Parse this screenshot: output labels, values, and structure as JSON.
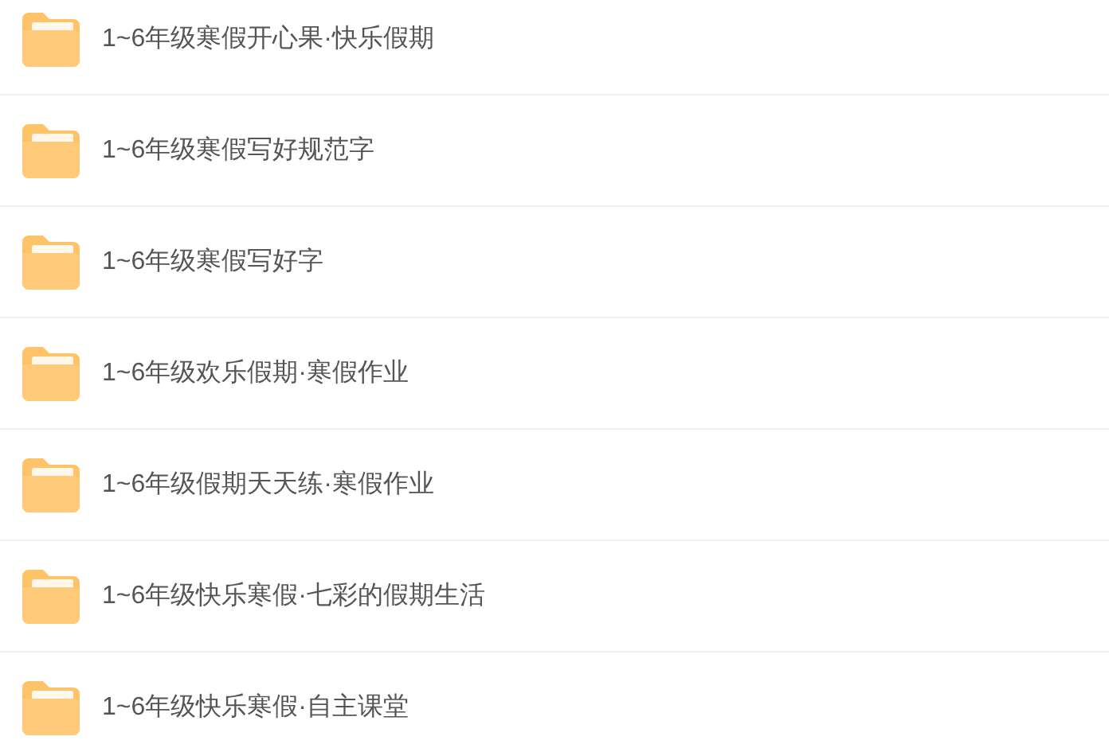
{
  "folders": [
    {
      "name": "1~6年级寒假开心果·快乐假期"
    },
    {
      "name": "1~6年级寒假写好规范字"
    },
    {
      "name": "1~6年级寒假写好字"
    },
    {
      "name": "1~6年级欢乐假期·寒假作业"
    },
    {
      "name": "1~6年级假期天天练·寒假作业"
    },
    {
      "name": "1~6年级快乐寒假·七彩的假期生活"
    },
    {
      "name": "1~6年级快乐寒假·自主课堂"
    }
  ]
}
